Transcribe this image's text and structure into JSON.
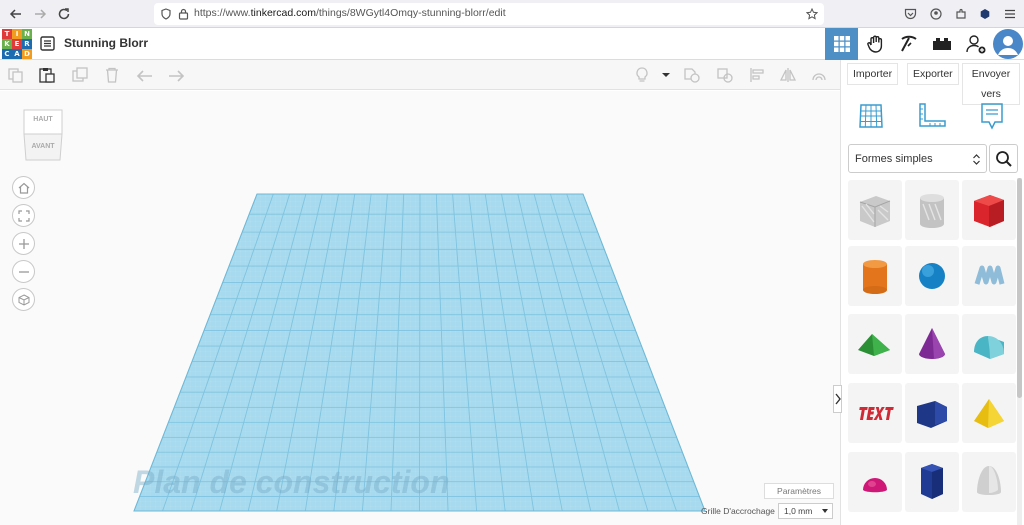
{
  "browser": {
    "url_prefix": "https://www.",
    "url_domain": "tinkercad.com",
    "url_path": "/things/8WGytl4Omqy-stunning-blorr/edit"
  },
  "header": {
    "logo_letters": [
      "T",
      "I",
      "N",
      "K",
      "E",
      "R",
      "C",
      "A",
      "D"
    ],
    "title": "Stunning Blorr"
  },
  "side_panel": {
    "import_label": "Importer",
    "export_label": "Exporter",
    "send_label": "Envoyer vers",
    "shape_category": "Formes simples"
  },
  "viewcube": {
    "top": "HAUT",
    "front": "AVANT"
  },
  "workplane": {
    "label": "Plan de construction",
    "params_label": "Paramètres",
    "snap_label": "Grille D'accrochage",
    "snap_value": "1,0 mm"
  },
  "colors": {
    "accent": "#4e8fc6",
    "grid": "#9fd6ea",
    "logo_blue": "#1d6bb0",
    "logo_green": "#6ab04c",
    "logo_red": "#e03a3a",
    "logo_orange": "#f29c1f"
  },
  "shapes": [
    {
      "name": "box-hole",
      "color": "#b9b9b9"
    },
    {
      "name": "cylinder-hole",
      "color": "#b9b9b9"
    },
    {
      "name": "box",
      "color": "#e32a2a"
    },
    {
      "name": "cylinder",
      "color": "#e8791f"
    },
    {
      "name": "sphere",
      "color": "#1a8ccd"
    },
    {
      "name": "scribble",
      "color": "#9ac4dd"
    },
    {
      "name": "roof",
      "color": "#2e9a3a"
    },
    {
      "name": "cone",
      "color": "#8a2f9e"
    },
    {
      "name": "round-roof",
      "color": "#4fb8c8"
    },
    {
      "name": "text",
      "color": "#d8323f"
    },
    {
      "name": "polygon",
      "color": "#223c93"
    },
    {
      "name": "pyramid",
      "color": "#f0c816"
    },
    {
      "name": "half-sphere",
      "color": "#d11f7a"
    },
    {
      "name": "hexagonal-prism",
      "color": "#233e96"
    },
    {
      "name": "paraboloid",
      "color": "#d8d8d8"
    }
  ]
}
